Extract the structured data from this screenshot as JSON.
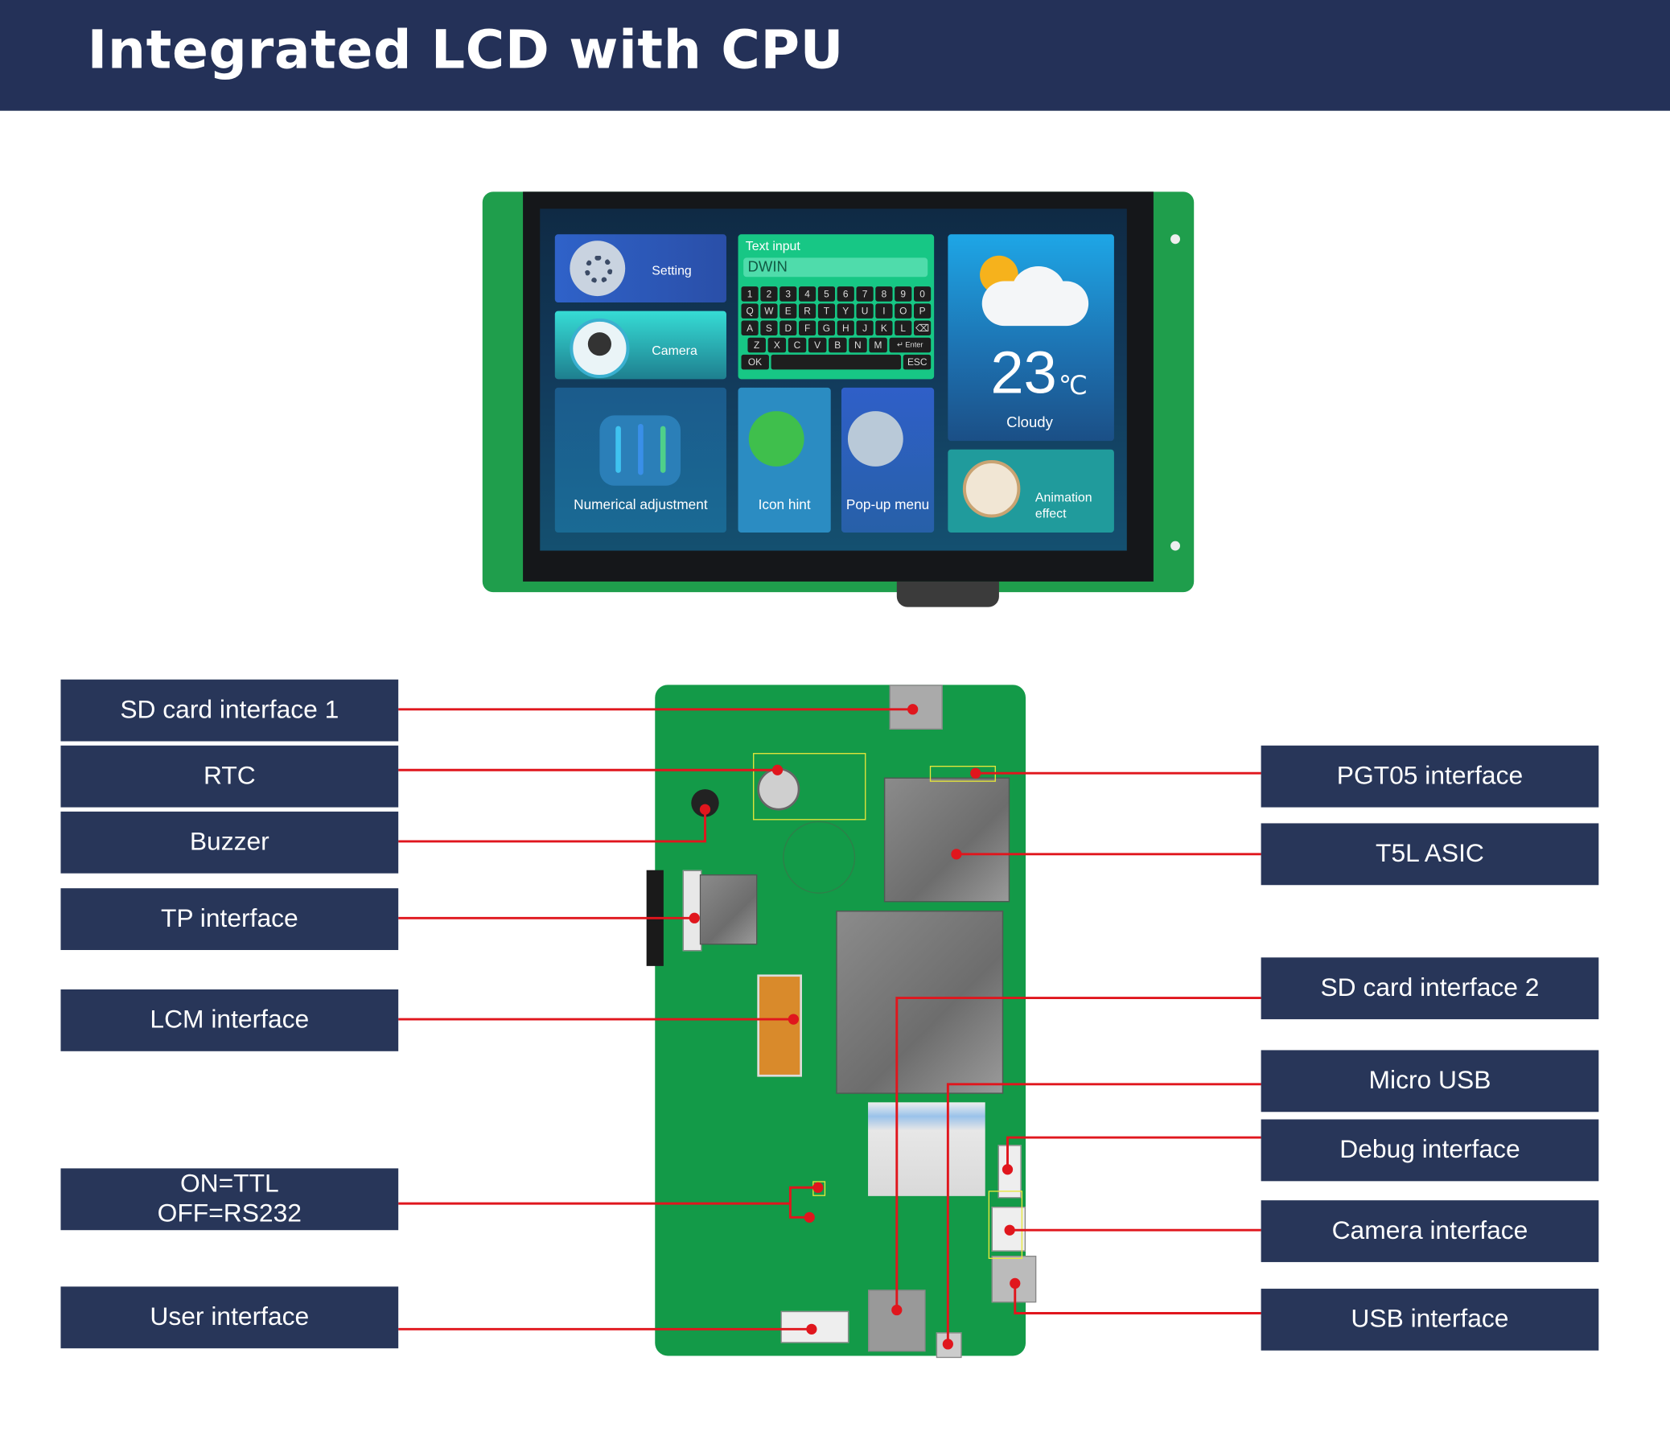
{
  "header": {
    "title": "Integrated LCD with CPU"
  },
  "screen": {
    "setting": "Setting",
    "camera": "Camera",
    "text_input": {
      "title": "Text input",
      "value": "DWIN",
      "rows": [
        [
          "1",
          "2",
          "3",
          "4",
          "5",
          "6",
          "7",
          "8",
          "9",
          "0"
        ],
        [
          "Q",
          "W",
          "E",
          "R",
          "T",
          "Y",
          "U",
          "I",
          "O",
          "P"
        ],
        [
          "A",
          "S",
          "D",
          "F",
          "G",
          "H",
          "J",
          "K",
          "L",
          "⌫"
        ],
        [
          "Z",
          "X",
          "C",
          "V",
          "B",
          "N",
          "M",
          "↵ Enter"
        ]
      ],
      "ok": "OK",
      "esc": "ESC"
    },
    "weather": {
      "temp": "23",
      "unit": "℃",
      "condition": "Cloudy"
    },
    "numerical": "Numerical adjustment",
    "icon_hint": "Icon hint",
    "popup": "Pop-up menu",
    "animation": "Animation effect"
  },
  "labels_left": [
    "SD card interface 1",
    "RTC",
    "Buzzer",
    "TP interface",
    "LCM interface",
    "ON=TTL\nOFF=RS232",
    "User interface"
  ],
  "labels_right": [
    "PGT05 interface",
    "T5L ASIC",
    "SD card interface 2",
    "Micro USB",
    "Debug interface",
    "Camera interface",
    "USB interface"
  ],
  "colors": {
    "header": "#243158",
    "label": "#283659",
    "leader": "#e0161d",
    "pcb": "#139a48",
    "highlight": "#e8e83a"
  }
}
